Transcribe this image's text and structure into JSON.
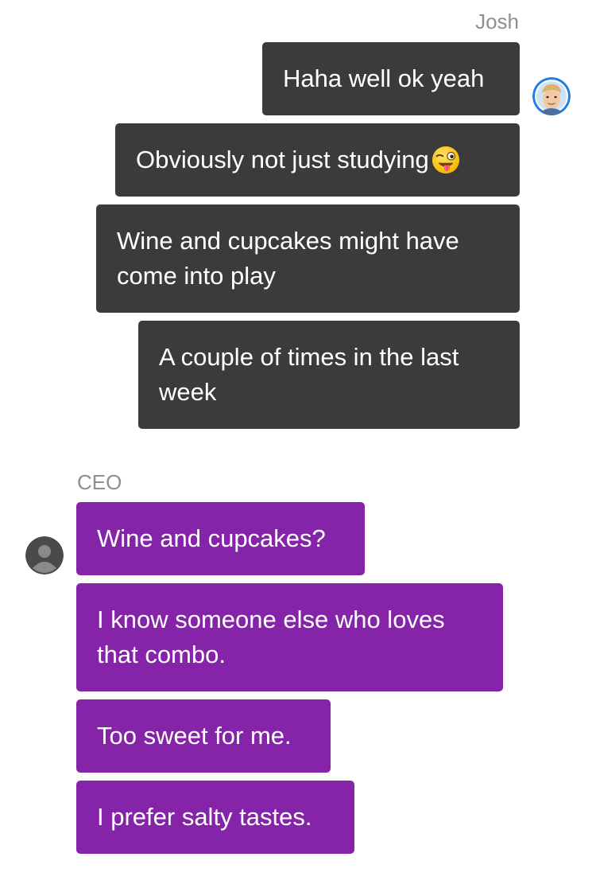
{
  "josh": {
    "name": "Josh",
    "avatar_icon": "memoji-avatar-icon",
    "messages": [
      {
        "text": "Haha well ok yeah"
      },
      {
        "text": "Obviously not just studying",
        "emoji": "winking-tongue-emoji-icon"
      },
      {
        "text": "Wine and cupcakes might have come into play"
      },
      {
        "text": "A couple of times in the last week"
      }
    ]
  },
  "ceo": {
    "name": "CEO",
    "avatar_icon": "default-person-avatar-icon",
    "messages": [
      {
        "text": "Wine and cupcakes?"
      },
      {
        "text": "I know someone else who loves that combo."
      },
      {
        "text": "Too sweet for me."
      },
      {
        "text": "I prefer salty tastes."
      }
    ]
  },
  "colors": {
    "outgoing_bubble": "#3b3b3b",
    "incoming_bubble": "#8524a9",
    "name_label": "#8e8e93",
    "bubble_text": "#ffffff"
  }
}
